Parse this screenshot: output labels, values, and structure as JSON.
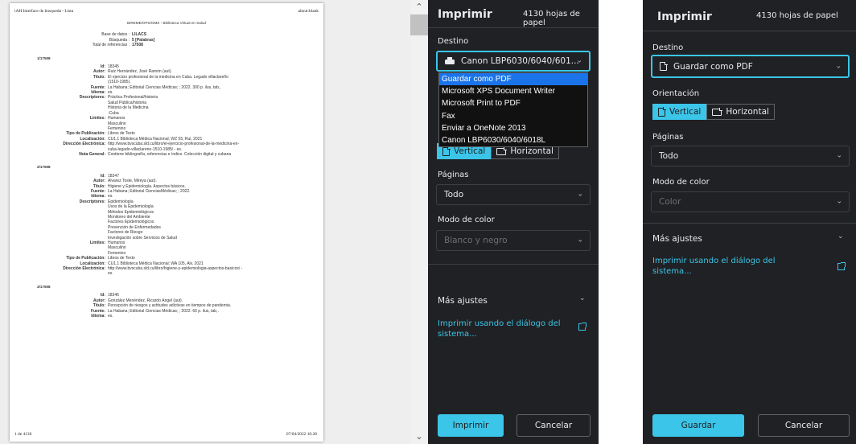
{
  "preview": {
    "header_left": "iAH Interface de busqueda - Lista",
    "header_right": "about:blank",
    "footer_left": "1 de 4130",
    "footer_right": "07/04/2022 10:28",
    "center_line": "BIREME/OPS/OMS - Biblioteca Virtual en Salud",
    "meta": [
      {
        "k": "Base de datos :",
        "v": "LILACS"
      },
      {
        "k": "Búsqueda :",
        "v": "5 [Palabras]"
      },
      {
        "k": "Total de referencias :",
        "v": "17508"
      }
    ],
    "records": [
      {
        "head": "1/17508",
        "fields": [
          {
            "k": "Id:",
            "v": [
              "18345"
            ]
          },
          {
            "k": "Autor:",
            "v": [
              "Ruiz Hernández, José Ramón (aut)."
            ]
          },
          {
            "k": "Título:",
            "v": [
              "El ejercicio profesional de la medicina en Cuba. Legado villaclareño",
              "(1510-1985)."
            ]
          },
          {
            "k": "Fuente:",
            "v": [
              "La Habana; Editorial Ciencias Médicas; ; 2022. 300 p. ilus, tab,."
            ]
          },
          {
            "k": "Idioma:",
            "v": [
              "es."
            ]
          },
          {
            "k": "Descriptores:",
            "v": [
              "Práctica Profesional/historia",
              "Salud Pública/historia",
              "Historia de la Medicina",
              "-Cuba"
            ]
          },
          {
            "k": "Límites:",
            "v": [
              "Humanos",
              "Masculino",
              "Femenino"
            ]
          },
          {
            "k": "Tipo de Publicación:",
            "v": [
              "Libros de Texto"
            ]
          },
          {
            "k": "Localización:",
            "v": [
              "CU1.1 Biblioteca Médica Nacional; WZ 55, Rui, 2021"
            ]
          },
          {
            "k": "Dirección Electrónica:",
            "v": [
              "http://www.bvscuba.sld.cu/libro/el-ejercicio-profesional-de-la-medicina-en-",
              "cuba-legado-villaclareno-1510-1985/ - es."
            ]
          },
          {
            "k": "Nota General:",
            "v": [
              "Contiene bibliografía, referencias e índice. Colección digital y cubana"
            ]
          }
        ]
      },
      {
        "head": "2/17508",
        "fields": [
          {
            "k": "Id:",
            "v": [
              "18347"
            ]
          },
          {
            "k": "Autor:",
            "v": [
              "Álvarez Toste, Mireya (aut)."
            ]
          },
          {
            "k": "Título:",
            "v": [
              "Higiene y Epidemiología. Aspectos básicos."
            ]
          },
          {
            "k": "Fuente:",
            "v": [
              "La Habana; Editorial CienciasMédicas; ; 2022."
            ]
          },
          {
            "k": "Idioma:",
            "v": [
              "es."
            ]
          },
          {
            "k": "Descriptores:",
            "v": [
              "Epidemiología",
              "Usos de la Epidemiología",
              "Métodos Epidemiológicos",
              "Monitoreo del Ambiente",
              "Factores Epidemiológicos",
              "Prevención de Enfermedades",
              "Factores de Riesgo",
              "Investigación sobre Servicios de Salud"
            ]
          },
          {
            "k": "Límites:",
            "v": [
              "Humanos",
              "Masculino",
              "Femenino"
            ]
          },
          {
            "k": "Tipo de Publicación:",
            "v": [
              "Libros de Texto"
            ]
          },
          {
            "k": "Localización:",
            "v": [
              "CU1.1 Biblioteca Médica Nacional; WA 105, Alv, 2021"
            ]
          },
          {
            "k": "Dirección Electrónica:",
            "v": [
              "http://www.bvscuba.sld.cu/libro/higiene-y-epidemiologia-aspectos-basicos/ -",
              "es."
            ]
          }
        ]
      },
      {
        "head": "3/17508",
        "fields": [
          {
            "k": "Id:",
            "v": [
              "18346"
            ]
          },
          {
            "k": "Autor:",
            "v": [
              "González Menéndez, Ricardo Ángel (aut)."
            ]
          },
          {
            "k": "Título:",
            "v": [
              "Percepción de riesgos y actitudes adictivas en tiempos de pandemia."
            ]
          },
          {
            "k": "Fuente:",
            "v": [
              "La Habana; Editorial Ciencias Médicas; ; 2022. 66 p. ilus, tab,."
            ]
          },
          {
            "k": "Idioma:",
            "v": [
              "es."
            ]
          }
        ]
      }
    ]
  },
  "panel1": {
    "title": "Imprimir",
    "sheets": "4130 hojas de papel",
    "destino_label": "Destino",
    "destino_value": "Canon LBP6030/6040/601...",
    "dropdown_options": [
      "Guardar como PDF",
      "Microsoft XPS Document Writer",
      "Microsoft Print to PDF",
      "Fax",
      "Enviar a OneNote 2013",
      "Canon LBP6030/6040/6018L"
    ],
    "orient_vertical": "Vertical",
    "orient_horizontal": "Horizontal",
    "paginas_label": "Páginas",
    "paginas_value": "Todo",
    "color_label": "Modo de color",
    "color_value": "Blanco y negro",
    "more_label": "Más ajustes",
    "link_line1": "Imprimir usando el diálogo del",
    "link_line2": "sistema...",
    "primary_button": "Imprimir",
    "cancel_button": "Cancelar"
  },
  "panel2": {
    "title": "Imprimir",
    "sheets": "4130 hojas de papel",
    "destino_label": "Destino",
    "destino_value": "Guardar como PDF",
    "orient_label": "Orientación",
    "orient_vertical": "Vertical",
    "orient_horizontal": "Horizontal",
    "paginas_label": "Páginas",
    "paginas_value": "Todo",
    "color_label": "Modo de color",
    "color_value": "Color",
    "more_label": "Más ajustes",
    "link_line1": "Imprimir usando el diálogo del",
    "link_line2": "sistema...",
    "primary_button": "Guardar",
    "cancel_button": "Cancelar"
  },
  "colors": {
    "accent": "#3bc5e8",
    "panel_bg": "#202124",
    "highlight": "#1a73e8"
  },
  "icons": [
    "printer-icon",
    "document-icon",
    "chevron-down-icon",
    "open-external-icon"
  ]
}
